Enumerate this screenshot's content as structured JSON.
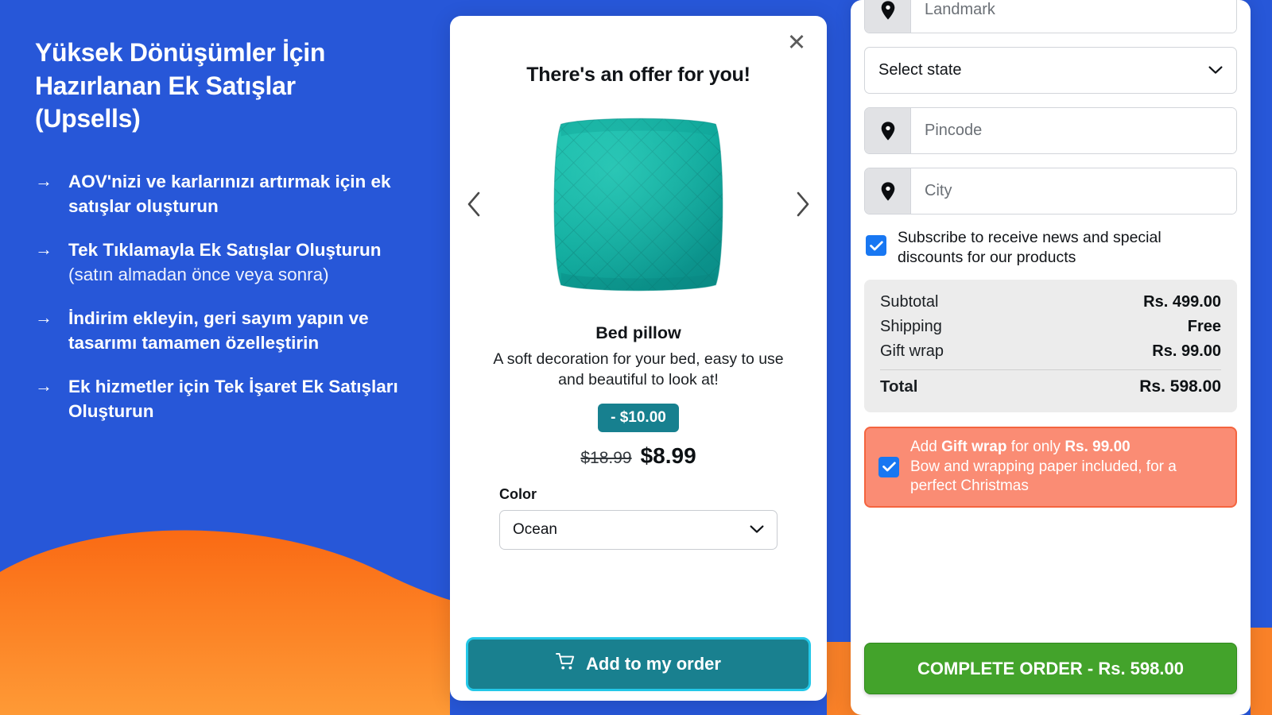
{
  "promo": {
    "heading": "Yüksek Dönüşümler İçin Hazırlanan Ek Satışlar (Upsells)",
    "arrow_glyph": "→",
    "bullets": [
      {
        "bold": "AOV'nizi ve karlarınızı artırmak için ek satışlar oluşturun",
        "light": ""
      },
      {
        "bold": "Tek Tıklamayla Ek Satışlar Oluşturun",
        "light": " (satın almadan önce veya sonra)"
      },
      {
        "bold": "İndirim ekleyin, geri sayım yapın ve tasarımı tamamen özelleştirin",
        "light": ""
      },
      {
        "bold": "Ek hizmetler için Tek İşaret Ek Satışları Oluşturun",
        "light": ""
      }
    ],
    "background_color": "#2757D8",
    "wave_color_top": "#FA6A14",
    "wave_color_bottom": "#FE9A36"
  },
  "offer_modal": {
    "close_label": "✕",
    "title": "There's an offer for you!",
    "prev_label": "‹",
    "next_label": "›",
    "product": {
      "image_alt": "teal quilted bed pillow",
      "name": "Bed pillow",
      "description": "A soft decoration for your bed, easy to use and beautiful to look at!",
      "discount_badge": "- $10.00",
      "price_old": "$18.99",
      "price_new": "$8.99"
    },
    "color_label": "Color",
    "color_selected": "Ocean",
    "add_button_label": "Add to my order",
    "accent_color": "#19808F",
    "accent_border_color": "#24C8E8"
  },
  "checkout": {
    "fields": [
      {
        "icon": "location-pin-icon",
        "placeholder": "Landmark",
        "value": ""
      },
      {
        "icon": "location-pin-icon",
        "placeholder": "Pincode",
        "value": ""
      },
      {
        "icon": "location-pin-icon",
        "placeholder": "City",
        "value": ""
      }
    ],
    "state_select_value": "Select state",
    "subscribe_label": "Subscribe to receive news and special discounts for our products",
    "subscribe_checked": true,
    "summary": {
      "rows": [
        {
          "label": "Subtotal",
          "value": "Rs. 499.00"
        },
        {
          "label": "Shipping",
          "value": "Free"
        },
        {
          "label": "Gift wrap",
          "value": "Rs. 99.00"
        }
      ],
      "total_label": "Total",
      "total_value": "Rs. 598.00"
    },
    "giftwrap": {
      "line1_prefix": "Add ",
      "line1_bold": "Gift wrap",
      "line1_middle": " for only ",
      "line1_price": "Rs. 99.00",
      "line2": "Bow and wrapping paper included, for a perfect Christmas",
      "checked": true,
      "background_color": "#FA8C74",
      "border_color": "#F4643F"
    },
    "complete_order_label": "COMPLETE ORDER - Rs. 598.00",
    "complete_order_color": "#43A32B"
  }
}
